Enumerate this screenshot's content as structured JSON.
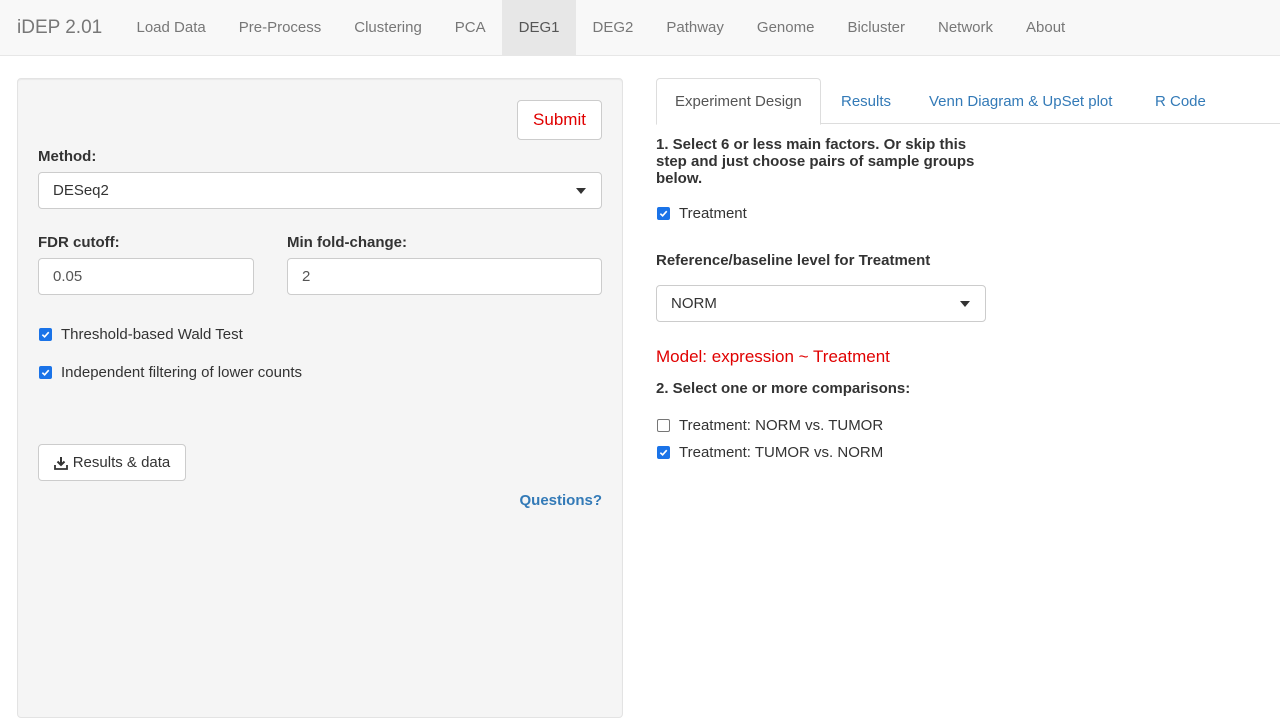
{
  "navbar": {
    "brand": "iDEP 2.01",
    "items": [
      "Load Data",
      "Pre-Process",
      "Clustering",
      "PCA",
      "DEG1",
      "DEG2",
      "Pathway",
      "Genome",
      "Bicluster",
      "Network",
      "About"
    ],
    "active": "DEG1"
  },
  "sidebar": {
    "submit_label": "Submit",
    "method_label": "Method:",
    "method_value": "DESeq2",
    "fdr_label": "FDR cutoff:",
    "fdr_value": "0.05",
    "fold_label": "Min fold-change:",
    "fold_value": "2",
    "wald_label": "Threshold-based Wald Test",
    "wald_checked": true,
    "filter_label": "Independent filtering of lower counts",
    "filter_checked": true,
    "download_label": "Results & data",
    "questions_label": "Questions?"
  },
  "tabs": {
    "items": [
      "Experiment Design",
      "Results",
      "Venn Diagram & UpSet plot",
      "R Code"
    ],
    "active": "Experiment Design"
  },
  "design": {
    "step1_line1": "1. Select 6 or less main factors. Or skip this",
    "step1_line2": "step and just choose pairs of sample groups",
    "step1_line3": "below.",
    "factor_label": "Treatment",
    "factor_checked": true,
    "reference_label": "Reference/baseline level for Treatment",
    "reference_value": "NORM",
    "model_text": "Model: expression ~ Treatment",
    "step2_label": "2. Select one or more comparisons:",
    "comparisons": [
      {
        "label": "Treatment: NORM vs. TUMOR",
        "checked": false
      },
      {
        "label": "Treatment: TUMOR vs. NORM",
        "checked": true
      }
    ]
  },
  "colors": {
    "accent": "#e00000",
    "link": "#337ab7",
    "checkbox": "#1a73e8"
  }
}
